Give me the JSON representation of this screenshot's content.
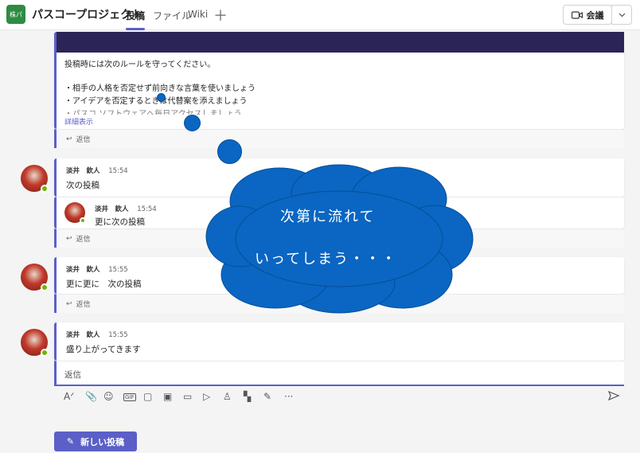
{
  "header": {
    "team_avatar": "株パ",
    "team_name": "パスコープロジェクト",
    "tabs": [
      {
        "label": "投稿"
      },
      {
        "label": "ファイル"
      },
      {
        "label": "Wiki"
      }
    ],
    "add_tab_icon": "plus-icon",
    "meet_label": "会議"
  },
  "announcement": {
    "lines": [
      "投稿時には次のルールを守ってください。",
      "・相手の人格を否定せず前向きな言葉を使いましょう",
      "・アイデアを否定するときは代替案を添えましょう",
      "・パスコ ソフトウェアへ毎日アクセスしましょう"
    ],
    "show_more": "詳細表示",
    "reply": "返信"
  },
  "posts": [
    {
      "author": "淡井　欽人",
      "time": "15:54",
      "message": "次の投稿",
      "reply_item": {
        "author": "淡井　欽人",
        "time": "15:54",
        "message": "更に次の投稿"
      },
      "reply": "返信"
    },
    {
      "author": "淡井　欽人",
      "time": "15:55",
      "message": "更に更に　次の投稿",
      "reply": "返信"
    },
    {
      "author": "淡井　欽人",
      "time": "15:55",
      "message": "盛り上がってきます"
    }
  ],
  "composer": {
    "placeholder": "返信"
  },
  "overlay": {
    "line1": "次第に流れて",
    "line2": "いってしまう・・・"
  },
  "new_post_label": "新しい投稿",
  "colors": {
    "accent": "#5b5fc7",
    "cloud": "#0a66c2",
    "banner": "#2b2557",
    "presence": "#6bb700"
  }
}
